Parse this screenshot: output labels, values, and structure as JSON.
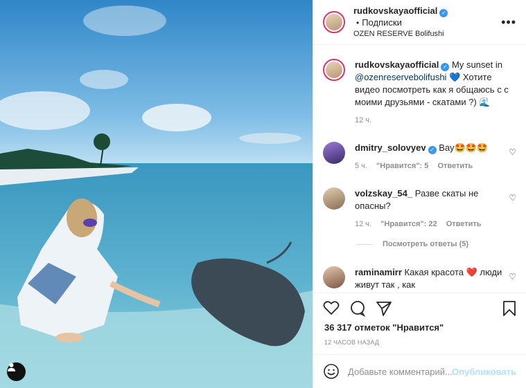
{
  "post": {
    "username": "rudkovskayaofficial",
    "follow_label": "Подписки",
    "location": "OZEN RESERVE Bolifushi"
  },
  "caption": {
    "username": "rudkovskayaofficial",
    "text_prefix": "My sunset in",
    "mention": "@ozenreservebolifushi",
    "text_rest": "Хотите видео посмотреть как я общаюсь с с моими друзьями - скатами ?)",
    "heart_emoji": "💙",
    "wave_emoji": "🌊",
    "time": "12 ч."
  },
  "comments": [
    {
      "username": "dmitry_solovyev",
      "verified": true,
      "text": "Вау🤩🤩🤩",
      "time": "5 ч.",
      "likes": "\"Нравится\": 5",
      "reply": "Ответить"
    },
    {
      "username": "volzskay_54_",
      "verified": false,
      "text": "Разве скаты не опасны?",
      "time": "12 ч.",
      "likes": "\"Нравится\": 22",
      "reply": "Ответить",
      "view_replies": "Посмотреть ответы (5)"
    },
    {
      "username": "raminamirr",
      "verified": false,
      "text": "Какая красота ❤️ люди живут так , как"
    }
  ],
  "likes_count": "36 317 отметок \"Нравится\"",
  "posted_ago": "12 ЧАСОВ НАЗАД",
  "add_comment": {
    "placeholder": "Добавьте комментарий...",
    "publish": "Опубликовать"
  },
  "colors": {
    "verified": "#3897f0",
    "link": "#00376b",
    "publish_disabled": "#b2dffc"
  }
}
